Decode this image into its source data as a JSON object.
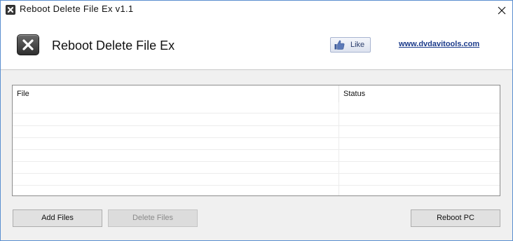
{
  "window": {
    "title": "Reboot Delete File Ex v1.1"
  },
  "header": {
    "app_name": "Reboot Delete File Ex",
    "like_label": "Like",
    "site_link": "www.dvdavitools.com"
  },
  "table": {
    "columns": [
      "File",
      "Status"
    ],
    "rows": []
  },
  "buttons": {
    "add_files": "Add Files",
    "delete_files": "Delete Files",
    "reboot_pc": "Reboot PC"
  },
  "icons": {
    "title_icon": "delete-x-icon",
    "logo_icon": "delete-x-icon",
    "like_icon": "thumbs-up-icon",
    "close_icon": "close-icon"
  },
  "colors": {
    "window_border": "#5a8fd0",
    "link": "#1a3a8a",
    "panel_bg": "#f0f0f0"
  }
}
